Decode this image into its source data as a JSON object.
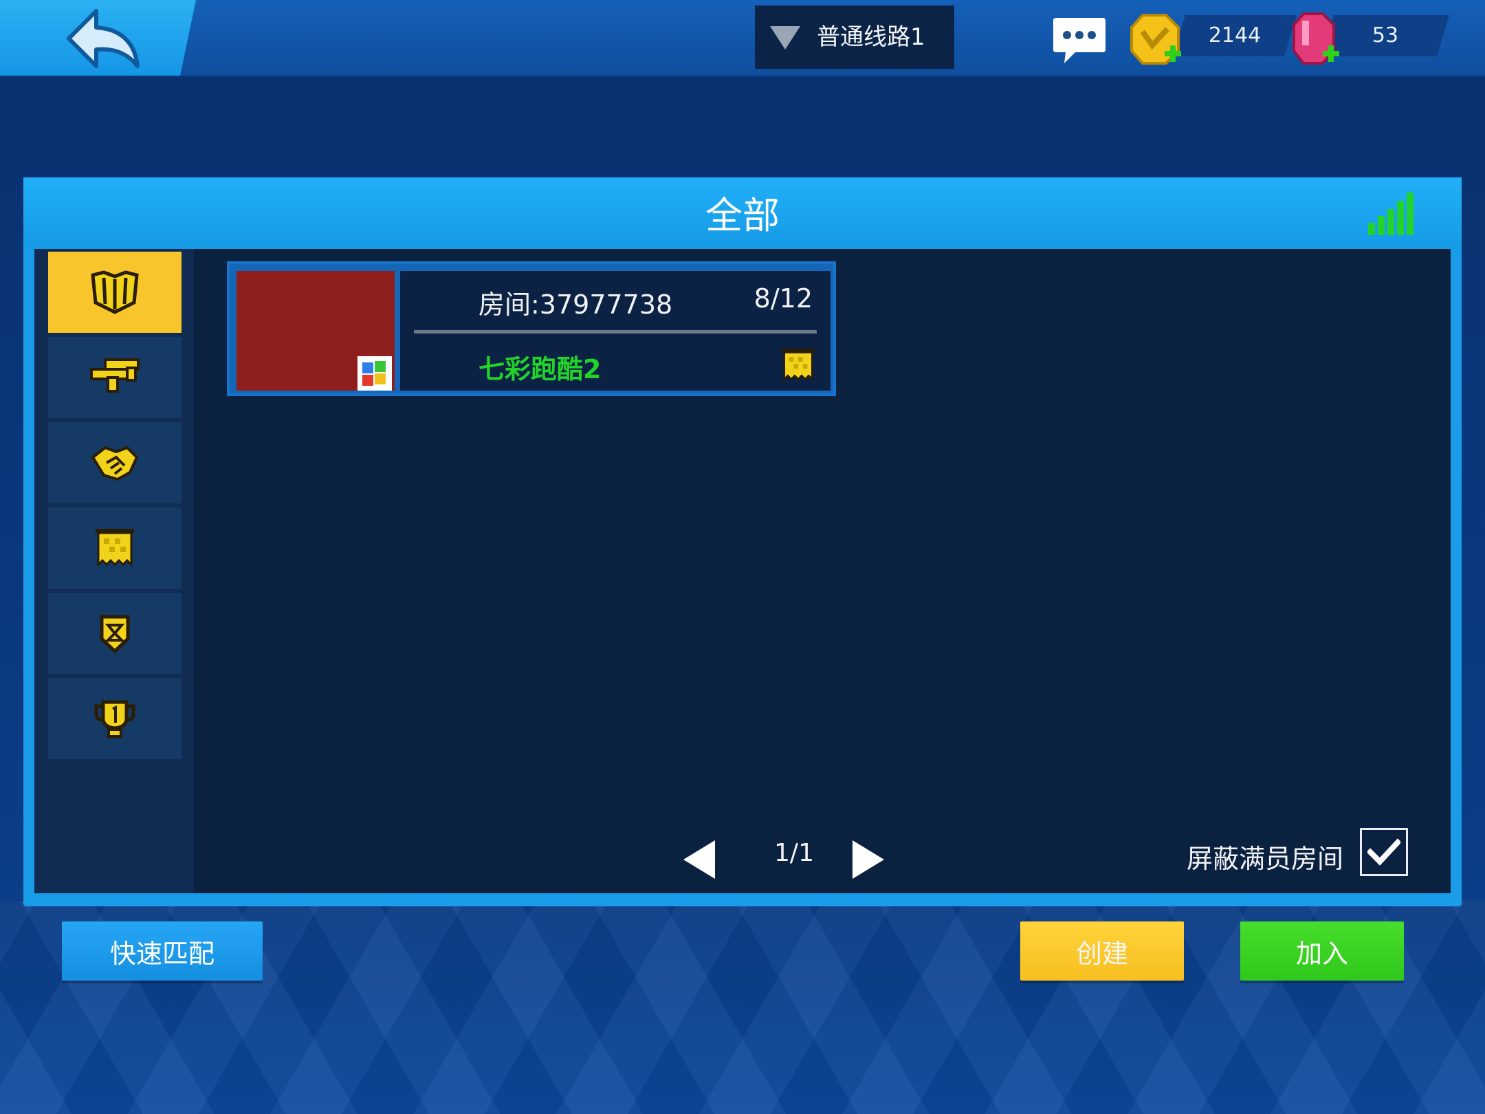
{
  "topbar": {
    "server_label": "普通线路1",
    "coins": "2144",
    "gems": "53",
    "icons": [
      "back-arrow-icon",
      "dropdown-triangle-icon",
      "chat-bubble-icon",
      "coin-icon",
      "gem-icon",
      "plus-icon"
    ]
  },
  "panel": {
    "title": "全部",
    "signal_icon": "signal-strength-icon"
  },
  "categories": [
    {
      "icon": "all-modes-icon",
      "active": true
    },
    {
      "icon": "guns-icon",
      "active": false
    },
    {
      "icon": "handshake-icon",
      "active": false
    },
    {
      "icon": "flag-icon",
      "active": false
    },
    {
      "icon": "badge-icon",
      "active": false
    },
    {
      "icon": "trophy-icon",
      "active": false
    }
  ],
  "rooms": [
    {
      "room_id": "房间:37977738",
      "players": "8/12",
      "map_name": "七彩跑酷2",
      "mode_icon": "colorful-mode-icon",
      "flag_icon": "flag-icon",
      "thumb_color": "#8e1f1d",
      "map_color": "#22d42a"
    }
  ],
  "pager": {
    "text": "1/1"
  },
  "filter": {
    "hide_full_label": "屏蔽满员房间",
    "hide_full_checked": true
  },
  "buttons": {
    "quick_match": "快速匹配",
    "create": "创建",
    "join": "加入"
  },
  "colors": {
    "accent_blue": "#1a9ce9",
    "active_yellow": "#f9c52c",
    "join_green": "#2fc81b",
    "create_yellow": "#f7be20"
  }
}
